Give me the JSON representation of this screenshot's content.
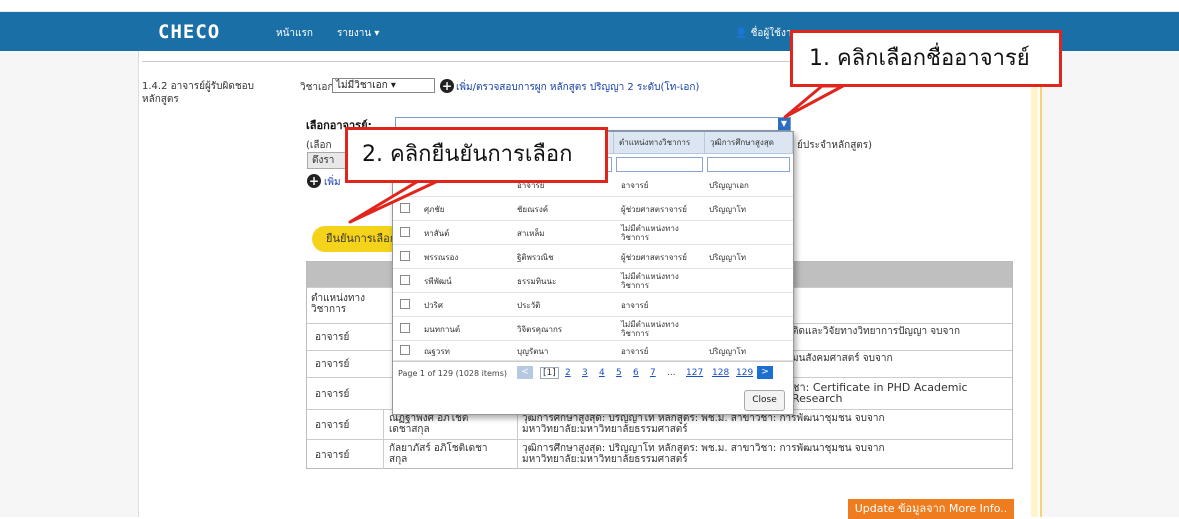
{
  "navbar": {
    "logo": "CHECO",
    "home": "หน้าแรก",
    "report": "รายงาน ▾",
    "user": "ชื่อผู้ใช้งา"
  },
  "section": {
    "label_line1": "1.4.2 อาจารย์ผู้รับผิดชอบ",
    "label_line2": "หลักสูตร",
    "major_label": "วิชาเอก :",
    "major_select": "ไม่มีวิชาเอก",
    "add_check_link": "เพิ่ม/ตรวจสอบการผูก หลักสูตร ปริญญา 2 ระดับ(โท-เอก)",
    "select_teacher_label": "เลือกอาจารย์:",
    "note_start": "(เลือก",
    "note_end": "ย์ประจำหลักสูตร)",
    "pull_button": "ดึงรา",
    "add_label": "เพิ่ม",
    "confirm_button": "ยืนยันการเลือก"
  },
  "popup": {
    "headers": [
      "",
      "",
      "",
      "ตำแหน่งทางวิชาการ",
      "วุฒิการศึกษาสูงสุด"
    ],
    "rows": [
      {
        "first": "",
        "last": "อาจารย์",
        "title": "อาจารย์",
        "degree": "ปริญญาเอก"
      },
      {
        "first": "ศุภชัย",
        "last": "ชัยณรงค์",
        "title": "ผู้ช่วยศาสตราจารย์",
        "degree": "ปริญญาโท"
      },
      {
        "first": "หาสันต์",
        "last": "สาเหล็ม",
        "title": "ไม่มีตำแหน่งทางวิชาการ",
        "degree": ""
      },
      {
        "first": "พรรณรอง",
        "last": "ฐิติพรวณิช",
        "title": "ผู้ช่วยศาสตราจารย์",
        "degree": "ปริญญาโท"
      },
      {
        "first": "รพีพัฒน์",
        "last": "ธรรมทินนะ",
        "title": "ไม่มีตำแหน่งทางวิชาการ",
        "degree": ""
      },
      {
        "first": "ปวริศ",
        "last": "ประวัติ",
        "title": "อาจารย์",
        "degree": ""
      },
      {
        "first": "มนทกานต์",
        "last": "วิจิตรคุณากร",
        "title": "ไม่มีตำแหน่งทางวิชาการ",
        "degree": ""
      },
      {
        "first": "ณฐวรท",
        "last": "บุญรัตนา",
        "title": "อาจารย์",
        "degree": "ปริญญาโท"
      }
    ],
    "page_info": "Page 1 of 129 (1028 items)",
    "pages": [
      "[1]",
      "2",
      "3",
      "4",
      "5",
      "6",
      "7",
      "...",
      "127",
      "128",
      "129"
    ],
    "close": "Close"
  },
  "table": {
    "header_col1": "ตำแหน่งทาง\nวิชาการ",
    "rows": [
      {
        "title": "อาจารย์",
        "name": "",
        "detail": "ติดและวิจัยทางวิทยาการปัญญา จบจาก"
      },
      {
        "title": "อาจารย์",
        "name": "",
        "detail": "มนสังคมศาสตร์ จบจาก"
      },
      {
        "title": "อาจารย์",
        "name": "",
        "detail": "ชา: Certificate in PHD Academic Research"
      },
      {
        "title": "อาจารย์",
        "name": "ณัฏฐาพงศ์ อภิโชติ\nเดชาสกุล",
        "detail": "วุฒิการศึกษาสูงสุด: ปริญญาโท หลักสูตร: พช.ม. สาขาวิชา: การพัฒนาชุมชน จบจาก\nมหาวิทยาลัย:มหาวิทยาลัยธรรมศาสตร์"
      },
      {
        "title": "อาจารย์",
        "name": "กัลยาภัสร์ อภิโชติเดชา\nสกุล",
        "detail": "วุฒิการศึกษาสูงสุด: ปริญญาโท หลักสูตร: พช.ม. สาขาวิชา: การพัฒนาชุมชน จบจาก\nมหาวิทยาลัย:มหาวิทยาลัยธรรมศาสตร์"
      }
    ]
  },
  "callouts": {
    "step1": "1. คลิกเลือกชื่ออาจารย์",
    "step2": "2. คลิกยืนยันการเลือก"
  },
  "update_button": "Update ข้อมูลจาก More Info..",
  "colors": {
    "navbar": "#1b6fa7",
    "callout_border": "#e0251c",
    "confirm_button": "#f5d31a",
    "update_button": "#ef7c1f",
    "pager_blue": "#1a4fc4"
  }
}
